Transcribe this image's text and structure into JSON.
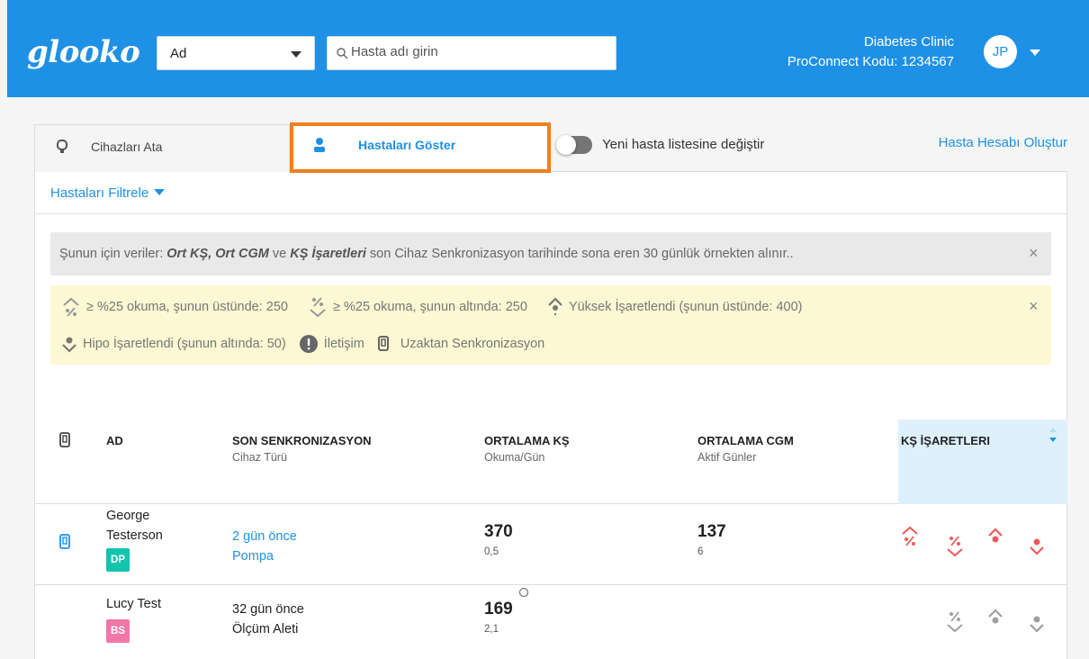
{
  "header": {
    "logo": "glooko",
    "search_type": "Ad",
    "search_placeholder": "Hasta adı girin",
    "clinic_name": "Diabetes Clinic",
    "proconnect": "ProConnect Kodu: 1234567",
    "avatar_initials": "JP"
  },
  "tabs": {
    "assign_devices": "Cihazları Ata",
    "show_patients": "Hastaları Göster"
  },
  "toggle_label": "Yeni hasta listesine değiştir",
  "create_account": "Hasta Hesabı Oluştur",
  "filter_label": "Hastaları Filtrele",
  "info": {
    "prefix": "Şunun için veriler: ",
    "bold": "Ort KŞ, Ort CGM",
    "mid": " ve ",
    "bold2": "KŞ İşaretleri",
    "suffix": " son Cihaz Senkronizasyon tarihinde sona eren 30 günlük örnekten alınır..",
    "close": "×"
  },
  "legend": {
    "above": "≥ %25 okuma, şunun üstünde: 250",
    "below": "≥ %25 okuma, şunun altında: 250",
    "high": "Yüksek İşaretlendi (şunun üstünde: 400)",
    "hypo": "Hipo İşaretlendi (şunun altında: 50)",
    "contact": "İletişim",
    "remote": "Uzaktan Senkronizasyon",
    "close": "×"
  },
  "table": {
    "col_name": "AD",
    "col_sync": "SON SENKRONIZASYON",
    "col_sync_sub": "Cihaz Türü",
    "col_bg": "ORTALAMA KŞ",
    "col_bg_sub": "Okuma/Gün",
    "col_cgm": "ORTALAMA CGM",
    "col_cgm_sub": "Aktif Günler",
    "col_flags": "KŞ İŞARETLERI",
    "rows": [
      {
        "first": "George",
        "last": "Testerson",
        "badge": "DP",
        "badge_color": "#13c4ad",
        "sync": "2 gün önce",
        "device": "Pompa",
        "avg_bg": "370",
        "reads": "0,5",
        "avg_cgm": "137",
        "active_days": "6"
      },
      {
        "first": "Lucy Test",
        "badge": "BS",
        "badge_color": "#f277a8",
        "sync": "32 gün önce",
        "device": "Ölçüm Aleti",
        "avg_bg": "169",
        "reads": "2,1"
      }
    ]
  },
  "colors": {
    "brand": "#1e91e6",
    "highlight": "#f07f1e",
    "flag_red": "#f05a5a",
    "flag_grey": "#a0a0a0"
  }
}
